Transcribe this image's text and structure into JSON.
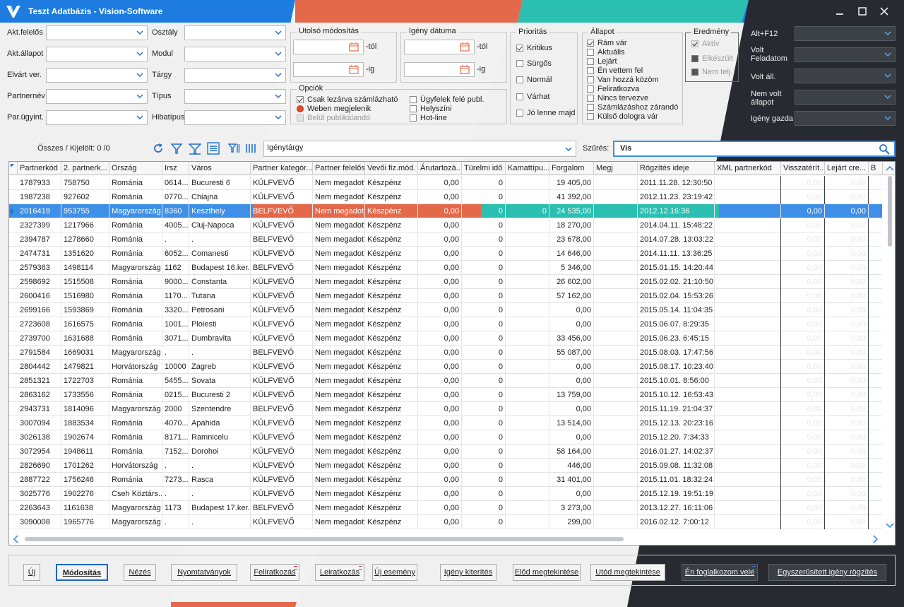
{
  "window": {
    "title": "Teszt Adatbázis - Vision-Software",
    "colors": {
      "stripe_orange": "#e4694a",
      "stripe_teal": "#2abfb0",
      "stripe_blue": "#1e7ce0",
      "dark": "#272b31",
      "selection": "#3d8fe8"
    }
  },
  "filters": {
    "left": [
      {
        "label": "Akt.felelős",
        "value": ""
      },
      {
        "label": "Akt.állapot",
        "value": ""
      },
      {
        "label": "Elvárt ver.",
        "value": ""
      },
      {
        "label": "Partnernév",
        "value": ""
      },
      {
        "label": "Par.ügyint.",
        "value": ""
      }
    ],
    "mid": [
      {
        "label": "Osztály",
        "value": ""
      },
      {
        "label": "Modul",
        "value": ""
      },
      {
        "label": "Tárgy",
        "value": ""
      },
      {
        "label": "Típus",
        "value": ""
      },
      {
        "label": "Hibatípus",
        "value": ""
      }
    ],
    "last_modified": {
      "title": "Utolsó módosítás",
      "from_suffix": "-tól",
      "to_suffix": "-ig"
    },
    "request_date": {
      "title": "Igény dátuma",
      "from_suffix": "-tól",
      "to_suffix": "-ig"
    },
    "options": {
      "title": "Opciók",
      "items": [
        {
          "label": "Csak lezárva számlázható",
          "type": "check",
          "checked": true,
          "disabled": false
        },
        {
          "label": "Weben megjelenik",
          "type": "radio",
          "checked": true,
          "disabled": false
        },
        {
          "label": "Belül publikálandó",
          "type": "check",
          "checked": false,
          "disabled": true
        },
        {
          "label": "Ügyfelek felé publ.",
          "type": "check",
          "checked": false,
          "disabled": false
        },
        {
          "label": "Helyszíni",
          "type": "check",
          "checked": false,
          "disabled": false
        },
        {
          "label": "Hot-line",
          "type": "check",
          "checked": false,
          "disabled": false
        }
      ]
    },
    "priority": {
      "title": "Prioritás",
      "items": [
        {
          "label": "Kritikus",
          "checked": true
        },
        {
          "label": "Sürgős",
          "checked": false
        },
        {
          "label": "Normál",
          "checked": false
        },
        {
          "label": "Várhat",
          "checked": false
        },
        {
          "label": "Jó lenne majd",
          "checked": false
        }
      ]
    },
    "status": {
      "title": "Állapot",
      "items": [
        {
          "label": "Rám vár",
          "checked": true
        },
        {
          "label": "Aktuális",
          "checked": false
        },
        {
          "label": "Lejárt",
          "checked": false
        },
        {
          "label": "Én vettem fel",
          "checked": false
        },
        {
          "label": "Van hozzá közöm",
          "checked": false
        },
        {
          "label": "Feliratkozva",
          "checked": false
        },
        {
          "label": "Nincs tervezve",
          "checked": false
        },
        {
          "label": "Számlázáshoz zárandó",
          "checked": false
        },
        {
          "label": "Külső dologra vár",
          "checked": false
        }
      ]
    },
    "result": {
      "title": "Eredmény",
      "items": [
        {
          "label": "Aktív",
          "checked": true
        },
        {
          "label": "Elkészült",
          "checked": false
        },
        {
          "label": "Nem telj.",
          "checked": false
        }
      ]
    },
    "right": [
      {
        "label": "Alt+F12",
        "value": ""
      },
      {
        "label": "Volt\nFeladatom",
        "value": ""
      },
      {
        "label": "Volt áll.",
        "value": ""
      },
      {
        "label": "Nem volt\nállapot",
        "value": ""
      },
      {
        "label": "Igény gazda",
        "value": ""
      }
    ]
  },
  "toolbar": {
    "count_label": "Összes / Kijelölt: 0 /0",
    "subject_combo": "Igénytárgy",
    "filter_label": "Szűrés:",
    "filter_value": "Vis"
  },
  "grid": {
    "columns": [
      "Partnerkód",
      "2. partnerk...",
      "Ország",
      "Irsz",
      "Város",
      "Partner kategór...",
      "Partner felelős",
      "Vevői fiz.mód.",
      "Árutartozá...",
      "Türelmi idő",
      "Kamattípu...",
      "Forgalom",
      "Megj",
      "Rögzítés ideje",
      "XML partnerkód",
      "Visszatérít...",
      "Lejárt cre...",
      "B"
    ],
    "selected_index": 2,
    "rows": [
      [
        "1787933",
        "758750",
        "Románia",
        "0614...",
        "Bucuresti 6",
        "KÜLFVEVŐ",
        "Nem megadott",
        "Készpénz",
        "0,00",
        "0",
        "",
        "19 405,00",
        "",
        "2011.11.28. 12:30:50",
        "",
        "0,00",
        "0,00"
      ],
      [
        "1987238",
        "927602",
        "Románia",
        "0770...",
        "Chiajna",
        "KÜLFVEVŐ",
        "Nem megadott",
        "Készpénz",
        "0,00",
        "0",
        "",
        "41 392,00",
        "",
        "2012.11.23. 23:19:42",
        "",
        "0,00",
        "0,00"
      ],
      [
        "2016419",
        "953755",
        "Magyarország",
        "8360",
        "Keszthely",
        "BELFVEVŐ",
        "Nem megadott",
        "Készpénz",
        "0,00",
        "0",
        "0",
        "24 535,00",
        "",
        "2012.12.16:36",
        "",
        "0,00",
        "0,00"
      ],
      [
        "2327399",
        "1217966",
        "Románia",
        "4005...",
        "Cluj-Napoca",
        "KÜLFVEVŐ",
        "Nem megadott",
        "Készpénz",
        "0,00",
        "0",
        "",
        "18 270,00",
        "",
        "2014.04.11. 15:48:22",
        "",
        "0,00",
        "0,00"
      ],
      [
        "2394787",
        "1278660",
        "Románia",
        ".",
        ".",
        "BELFVEVŐ",
        "Nem megadott",
        "Készpénz",
        "0,00",
        "0",
        "",
        "23 678,00",
        "",
        "2014.07.28. 13:03:22",
        "",
        "0,00",
        "0,00"
      ],
      [
        "2474731",
        "1351620",
        "Románia",
        "6052...",
        "Comanesti",
        "KÜLFVEVŐ",
        "Nem megadott",
        "Készpénz",
        "0,00",
        "0",
        "",
        "14 646,00",
        "",
        "2014.11.11. 13:36:25",
        "",
        "0,00",
        "0,00"
      ],
      [
        "2579363",
        "1498114",
        "Magyarország",
        "1162",
        "Budapest 16.ker.",
        "BELFVEVŐ",
        "Nem megadott",
        "Készpénz",
        "0,00",
        "0",
        "",
        "5 346,00",
        "",
        "2015.01.15. 14:20:44",
        "",
        "0,00",
        "0,00"
      ],
      [
        "2598692",
        "1515508",
        "Románia",
        "9000...",
        "Constanta",
        "KÜLFVEVŐ",
        "Nem megadott",
        "Készpénz",
        "0,00",
        "0",
        "",
        "26 602,00",
        "",
        "2015.02.02. 21:10:50",
        "",
        "0,00",
        "0,00"
      ],
      [
        "2600416",
        "1516980",
        "Románia",
        "1170...",
        "Tutana",
        "KÜLFVEVŐ",
        "Nem megadott",
        "Készpénz",
        "0,00",
        "0",
        "",
        "57 162,00",
        "",
        "2015.02.04. 15:53:26",
        "",
        "0,00",
        "0,00"
      ],
      [
        "2699166",
        "1593869",
        "Románia",
        "3320...",
        "Petrosani",
        "KÜLFVEVŐ",
        "Nem megadott",
        "Készpénz",
        "0,00",
        "0",
        "",
        "0,00",
        "",
        "2015.05.14. 11:04:35",
        "",
        "0,00",
        "0,00"
      ],
      [
        "2723608",
        "1616575",
        "Románia",
        "1001...",
        "Ploiesti",
        "KÜLFVEVŐ",
        "Nem megadott",
        "Készpénz",
        "0,00",
        "0",
        "",
        "0,00",
        "",
        "2015.06.07. 8:29:35",
        "",
        "0,00",
        "0,00"
      ],
      [
        "2739700",
        "1631688",
        "Románia",
        "3071...",
        "Dumbravita",
        "KÜLFVEVŐ",
        "Nem megadott",
        "Készpénz",
        "0,00",
        "0",
        "",
        "33 456,00",
        "",
        "2015.06.23. 6:45:15",
        "",
        "0,00",
        "0,00"
      ],
      [
        "2791584",
        "1669031",
        "Magyarország",
        ".",
        ".",
        "BELFVEVŐ",
        "Nem megadott",
        "Készpénz",
        "0,00",
        "0",
        "",
        "55 087,00",
        "",
        "2015.08.03. 17:47:56",
        "",
        "0,00",
        "0,00"
      ],
      [
        "2804442",
        "1479821",
        "Horvátország",
        "10000",
        "Zagreb",
        "KÜLFVEVŐ",
        "Nem megadott",
        "Készpénz",
        "0,00",
        "0",
        "",
        "0,00",
        "",
        "2015.08.17. 10:23:40",
        "",
        "0,00",
        "0,00"
      ],
      [
        "2851321",
        "1722703",
        "Románia",
        "5455...",
        "Sovata",
        "KÜLFVEVŐ",
        "Nem megadott",
        "Készpénz",
        "0,00",
        "0",
        "",
        "0,00",
        "",
        "2015.10.01. 8:56:00",
        "",
        "0,00",
        "0,00"
      ],
      [
        "2863162",
        "1733556",
        "Románia",
        "0215...",
        "Bucuresti 2",
        "KÜLFVEVŐ",
        "Nem megadott",
        "Készpénz",
        "0,00",
        "0",
        "",
        "13 759,00",
        "",
        "2015.10.12. 16:53:43",
        "",
        "0,00",
        "0,00"
      ],
      [
        "2943731",
        "1814096",
        "Magyarország",
        "2000",
        "Szentendre",
        "BELFVEVŐ",
        "Nem megadott",
        "Készpénz",
        "0,00",
        "0",
        "",
        "0,00",
        "",
        "2015.11.19. 21:04:37",
        "",
        "0,00",
        "0,00"
      ],
      [
        "3007094",
        "1883534",
        "Románia",
        "4070...",
        "Apahida",
        "KÜLFVEVŐ",
        "Nem megadott",
        "Készpénz",
        "0,00",
        "0",
        "",
        "13 514,00",
        "",
        "2015.12.13. 20:23:16",
        "",
        "0,00",
        "0,00"
      ],
      [
        "3026138",
        "1902674",
        "Románia",
        "8171...",
        "Ramnicelu",
        "KÜLFVEVŐ",
        "Nem megadott",
        "Készpénz",
        "0,00",
        "0",
        "",
        "0,00",
        "",
        "2015.12.20. 7:34:33",
        "",
        "0,00",
        "0,00"
      ],
      [
        "3072954",
        "1948611",
        "Románia",
        "7152...",
        "Dorohoi",
        "KÜLFVEVŐ",
        "Nem megadott",
        "Készpénz",
        "0,00",
        "0",
        "",
        "58 164,00",
        "",
        "2016.01.27. 14:02:37",
        "",
        "0,00",
        "0,00"
      ],
      [
        "2826690",
        "1701262",
        "Horvátország",
        ".",
        ".",
        "KÜLFVEVŐ",
        "Nem megadott",
        "Készpénz",
        "0,00",
        "0",
        "",
        "446,00",
        "",
        "2015.09.08. 11:32:08",
        "",
        "0,00",
        "0,00"
      ],
      [
        "2887722",
        "1756246",
        "Románia",
        "7273...",
        "Rasca",
        "KÜLFVEVŐ",
        "Nem megadott",
        "Készpénz",
        "0,00",
        "0",
        "",
        "31 401,00",
        "",
        "2015.11.01. 18:32:24",
        "",
        "0,00",
        "0,00"
      ],
      [
        "3025776",
        "1902276",
        "Cseh Köztárs...",
        ".",
        ".",
        "KÜLFVEVŐ",
        "Nem megadott",
        "Készpénz",
        "0,00",
        "0",
        "",
        "0,00",
        "",
        "2015.12.19. 19:51:19",
        "",
        "0,00",
        "0,00"
      ],
      [
        "2263643",
        "1161638",
        "Magyarország",
        "1173",
        "Budapest 17.ker.",
        "BELFVEVŐ",
        "Nem megadott",
        "Készpénz",
        "0,00",
        "0",
        "",
        "3 273,00",
        "",
        "2013.12.27. 16:11:06",
        "",
        "0,00",
        "0,00"
      ],
      [
        "3090008",
        "1965776",
        "Magyarország",
        ".",
        ".",
        "KÜLFVEVŐ",
        "Nem megadott",
        "Készpénz",
        "0,00",
        "0",
        "",
        "299,00",
        "",
        "2016.02.12. 7:00:12",
        "",
        "0,00",
        "0,00"
      ]
    ]
  },
  "buttons": [
    {
      "label": "Új",
      "flag": ""
    },
    {
      "label": "Módosítás",
      "flag": "",
      "primary": true
    },
    {
      "label": "Nézés",
      "flag": ""
    },
    {
      "label": "Nyomtatványok",
      "flag": ""
    },
    {
      "label": "Feliratkozás",
      "flag": "red"
    },
    {
      "label": "Leiratkozás",
      "flag": "red"
    },
    {
      "label": "Új esemény",
      "flag": ""
    },
    {
      "label": "Igény kiterítés",
      "flag": ""
    },
    {
      "label": "Előd megtekintése",
      "flag": ""
    },
    {
      "label": "Utód megtekintése",
      "flag": ""
    },
    {
      "label": "Én foglalkozom vele",
      "flag": "blue"
    },
    {
      "label": "Egyszerűsített igény rögzítés",
      "flag": ""
    }
  ]
}
